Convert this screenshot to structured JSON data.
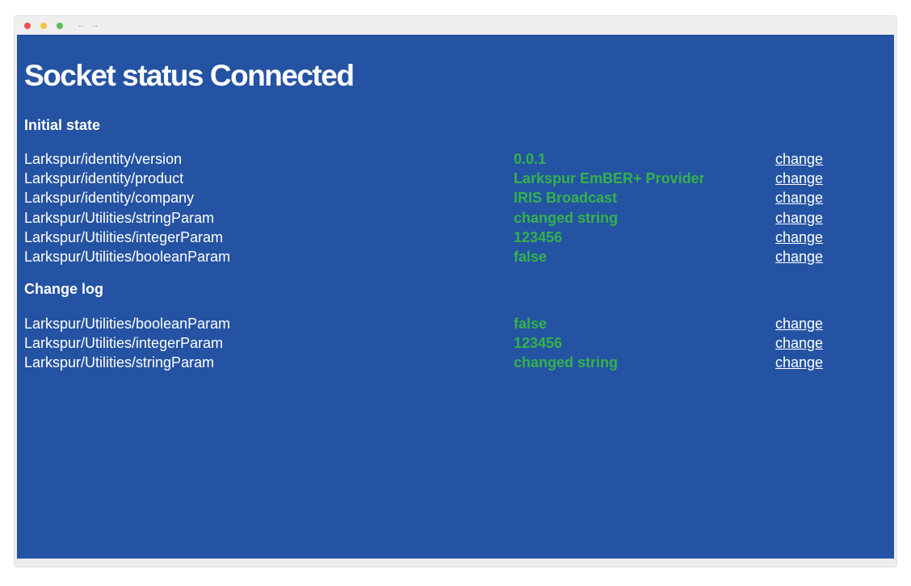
{
  "window": {
    "controls": {
      "close_color": "#ef5350",
      "minimize_color": "#f5c343",
      "maximize_color": "#5fbb59"
    },
    "nav": {
      "back_label": "←",
      "forward_label": "→"
    }
  },
  "page": {
    "title": "Socket status Connected",
    "background": "#2553a3",
    "value_color": "#33b24a"
  },
  "initial_state": {
    "heading": "Initial state",
    "rows": [
      {
        "path": "Larkspur/identity/version",
        "value": "0.0.1",
        "action": "change"
      },
      {
        "path": "Larkspur/identity/product",
        "value": "Larkspur EmBER+ Provider",
        "action": "change"
      },
      {
        "path": "Larkspur/identity/company",
        "value": "IRIS Broadcast",
        "action": "change"
      },
      {
        "path": "Larkspur/Utilities/stringParam",
        "value": "changed string",
        "action": "change"
      },
      {
        "path": "Larkspur/Utilities/integerParam",
        "value": "123456",
        "action": "change"
      },
      {
        "path": "Larkspur/Utilities/booleanParam",
        "value": "false",
        "action": "change"
      }
    ]
  },
  "change_log": {
    "heading": "Change log",
    "rows": [
      {
        "path": "Larkspur/Utilities/booleanParam",
        "value": "false",
        "action": "change"
      },
      {
        "path": "Larkspur/Utilities/integerParam",
        "value": "123456",
        "action": "change"
      },
      {
        "path": "Larkspur/Utilities/stringParam",
        "value": "changed string",
        "action": "change"
      }
    ]
  }
}
